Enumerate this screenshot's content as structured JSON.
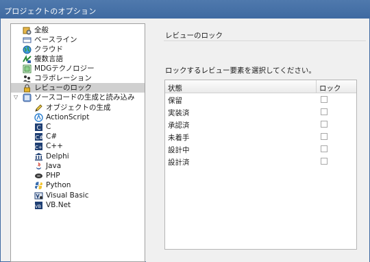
{
  "window": {
    "title": "プロジェクトのオプション"
  },
  "tree": {
    "items": [
      {
        "label": "全般",
        "icon": "gear-icon"
      },
      {
        "label": "ベースライン",
        "icon": "baseline-icon"
      },
      {
        "label": "クラウド",
        "icon": "globe-icon"
      },
      {
        "label": "複数言語",
        "icon": "translate-icon"
      },
      {
        "label": "MDGテクノロジー",
        "icon": "mdg-icon"
      },
      {
        "label": "コラボレーション",
        "icon": "people-icon"
      },
      {
        "label": "レビューのロック",
        "icon": "lock-icon",
        "selected": true
      },
      {
        "label": "ソースコードの生成と読み込み",
        "icon": "code-icon",
        "expanded": true
      },
      {
        "label": "オブジェクトの生成",
        "icon": "pencil-icon"
      },
      {
        "label": "ActionScript",
        "icon": "actionscript-icon"
      },
      {
        "label": "C",
        "icon": "c-icon"
      },
      {
        "label": "C#",
        "icon": "csharp-icon"
      },
      {
        "label": "C++",
        "icon": "cpp-icon"
      },
      {
        "label": "Delphi",
        "icon": "delphi-icon"
      },
      {
        "label": "Java",
        "icon": "java-icon"
      },
      {
        "label": "PHP",
        "icon": "php-icon"
      },
      {
        "label": "Python",
        "icon": "python-icon"
      },
      {
        "label": "Visual Basic",
        "icon": "visualbasic-icon"
      },
      {
        "label": "VB.Net",
        "icon": "vbnet-icon"
      }
    ]
  },
  "page": {
    "title": "レビューのロック",
    "instruction": "ロックするレビュー要素を選択してください。",
    "table": {
      "headers": {
        "status": "状態",
        "lock": "ロック"
      },
      "rows": [
        {
          "status": "保留",
          "locked": false
        },
        {
          "status": "実装済",
          "locked": false
        },
        {
          "status": "承認済",
          "locked": false
        },
        {
          "status": "未着手",
          "locked": false
        },
        {
          "status": "設計中",
          "locked": false
        },
        {
          "status": "設計済",
          "locked": false
        }
      ]
    }
  }
}
